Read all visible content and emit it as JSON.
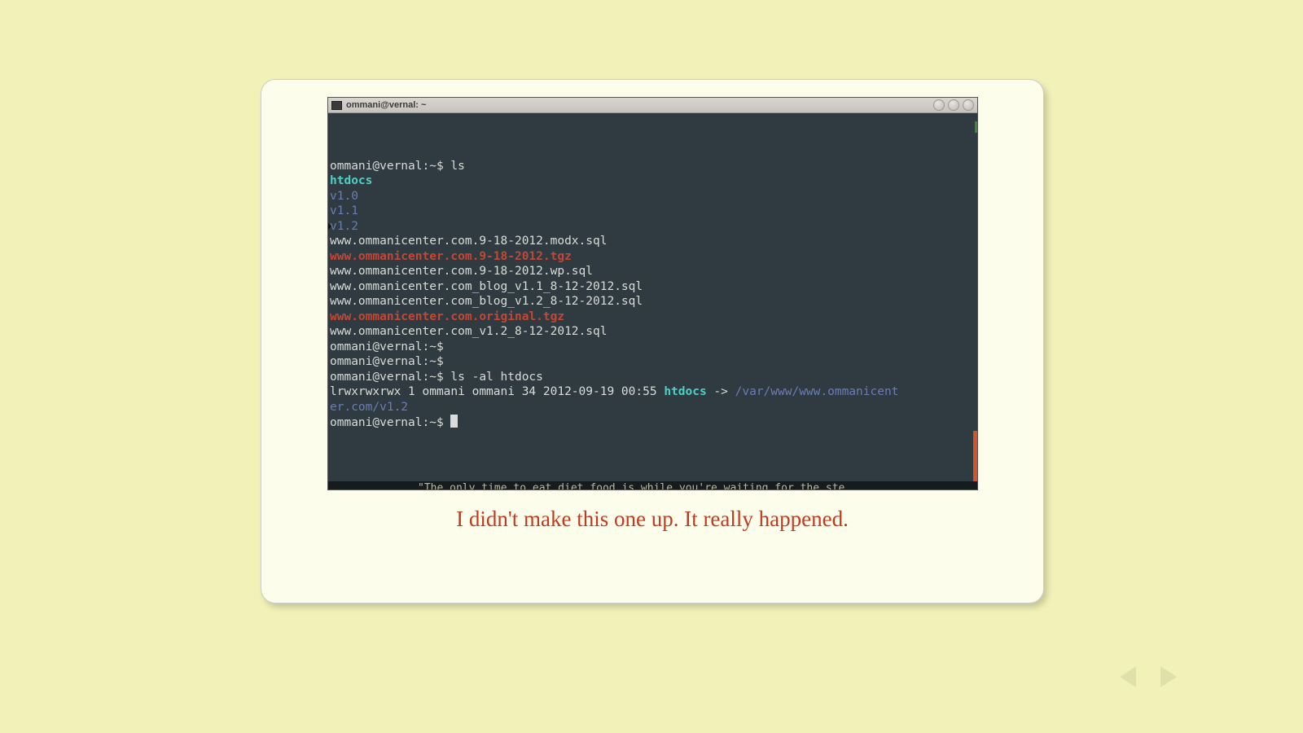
{
  "window": {
    "title": "ommani@vernal: ~"
  },
  "terminal": {
    "prompt1": "ommani@vernal:~$ ls",
    "ls_output": {
      "htdocs": "htdocs",
      "v10": "v1.0",
      "v11": "v1.1",
      "v12": "v1.2",
      "f1": "www.ommanicenter.com.9-18-2012.modx.sql",
      "f2": "www.ommanicenter.com.9-18-2012.tgz",
      "f3": "www.ommanicenter.com.9-18-2012.wp.sql",
      "f4": "www.ommanicenter.com_blog_v1.1_8-12-2012.sql",
      "f5": "www.ommanicenter.com_blog_v1.2_8-12-2012.sql",
      "f6": "www.ommanicenter.com.original.tgz",
      "f7": "www.ommanicenter.com_v1.2_8-12-2012.sql"
    },
    "prompt_empty1": "ommani@vernal:~$ ",
    "prompt_empty2": "ommani@vernal:~$ ",
    "prompt2": "ommani@vernal:~$ ls -al htdocs",
    "ls_long": {
      "perms": "lrwxrwxrwx 1 ommani ommani 34 2012-09-19 00:55 ",
      "linkname": "htdocs",
      "arrow": " -> ",
      "target_a": "/var/www/www.ommanicent",
      "target_b": "er.com/v1.2"
    },
    "prompt_final": "ommani@vernal:~$ ",
    "bottom_fragment": "\"The only time to eat diet food is while you're waiting for the ste"
  },
  "caption": "I didn't make this one up. It really happened."
}
